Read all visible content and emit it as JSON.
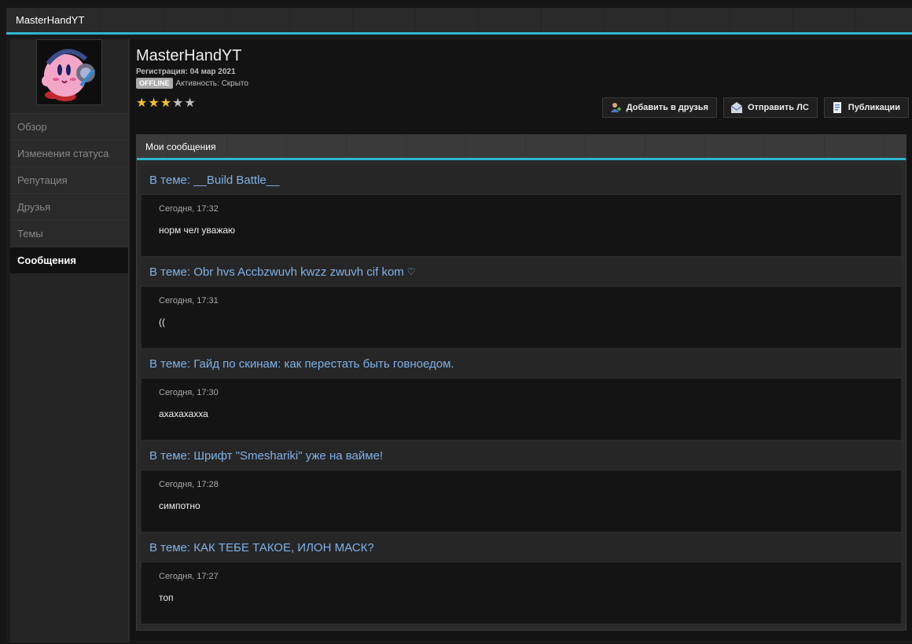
{
  "window": {
    "title": "MasterHandYT"
  },
  "profile": {
    "name": "MasterHandYT",
    "registration_label": "Регистрация:",
    "registration_date": "04 мар 2021",
    "status_badge": "OFFLINE",
    "activity": "Активность: Скрыто",
    "rating": {
      "filled": 3,
      "total": 5
    }
  },
  "actions": {
    "add_friend": "Добавить в друзья",
    "send_pm": "Отправить ЛС",
    "publications": "Публикации"
  },
  "nav": {
    "items": [
      {
        "label": "Обзор"
      },
      {
        "label": "Изменения статуса"
      },
      {
        "label": "Репутация"
      },
      {
        "label": "Друзья"
      },
      {
        "label": "Темы"
      },
      {
        "label": "Сообщения"
      }
    ],
    "active": "Сообщения"
  },
  "posts": {
    "header": "Мои сообщения",
    "items": [
      {
        "topic": "В теме: __Build Battle__",
        "date": "Сегодня, 17:32",
        "text": "норм чел уважаю"
      },
      {
        "topic": "В теме: Obr hvs Accbzwuvh kwzz zwuvh cif kom",
        "heart": "♡",
        "date": "Сегодня, 17:31",
        "text": "(("
      },
      {
        "topic": "В теме: Гайд по скинам: как перестать быть говноедом.",
        "date": "Сегодня, 17:30",
        "text": "ахахахахха"
      },
      {
        "topic": "В теме: Шрифт \"Smeshariki\" уже на вайме!",
        "date": "Сегодня, 17:28",
        "text": "симпотно"
      },
      {
        "topic": "В теме: КАК ТЕБЕ ТАКОЕ, ИЛОН МАСК?",
        "date": "Сегодня, 17:27",
        "text": "топ"
      }
    ]
  },
  "colors": {
    "accent": "#2fb6cf",
    "link": "#7fb2e8",
    "star_on": "#f2c129",
    "star_off": "#bdbdbd"
  }
}
